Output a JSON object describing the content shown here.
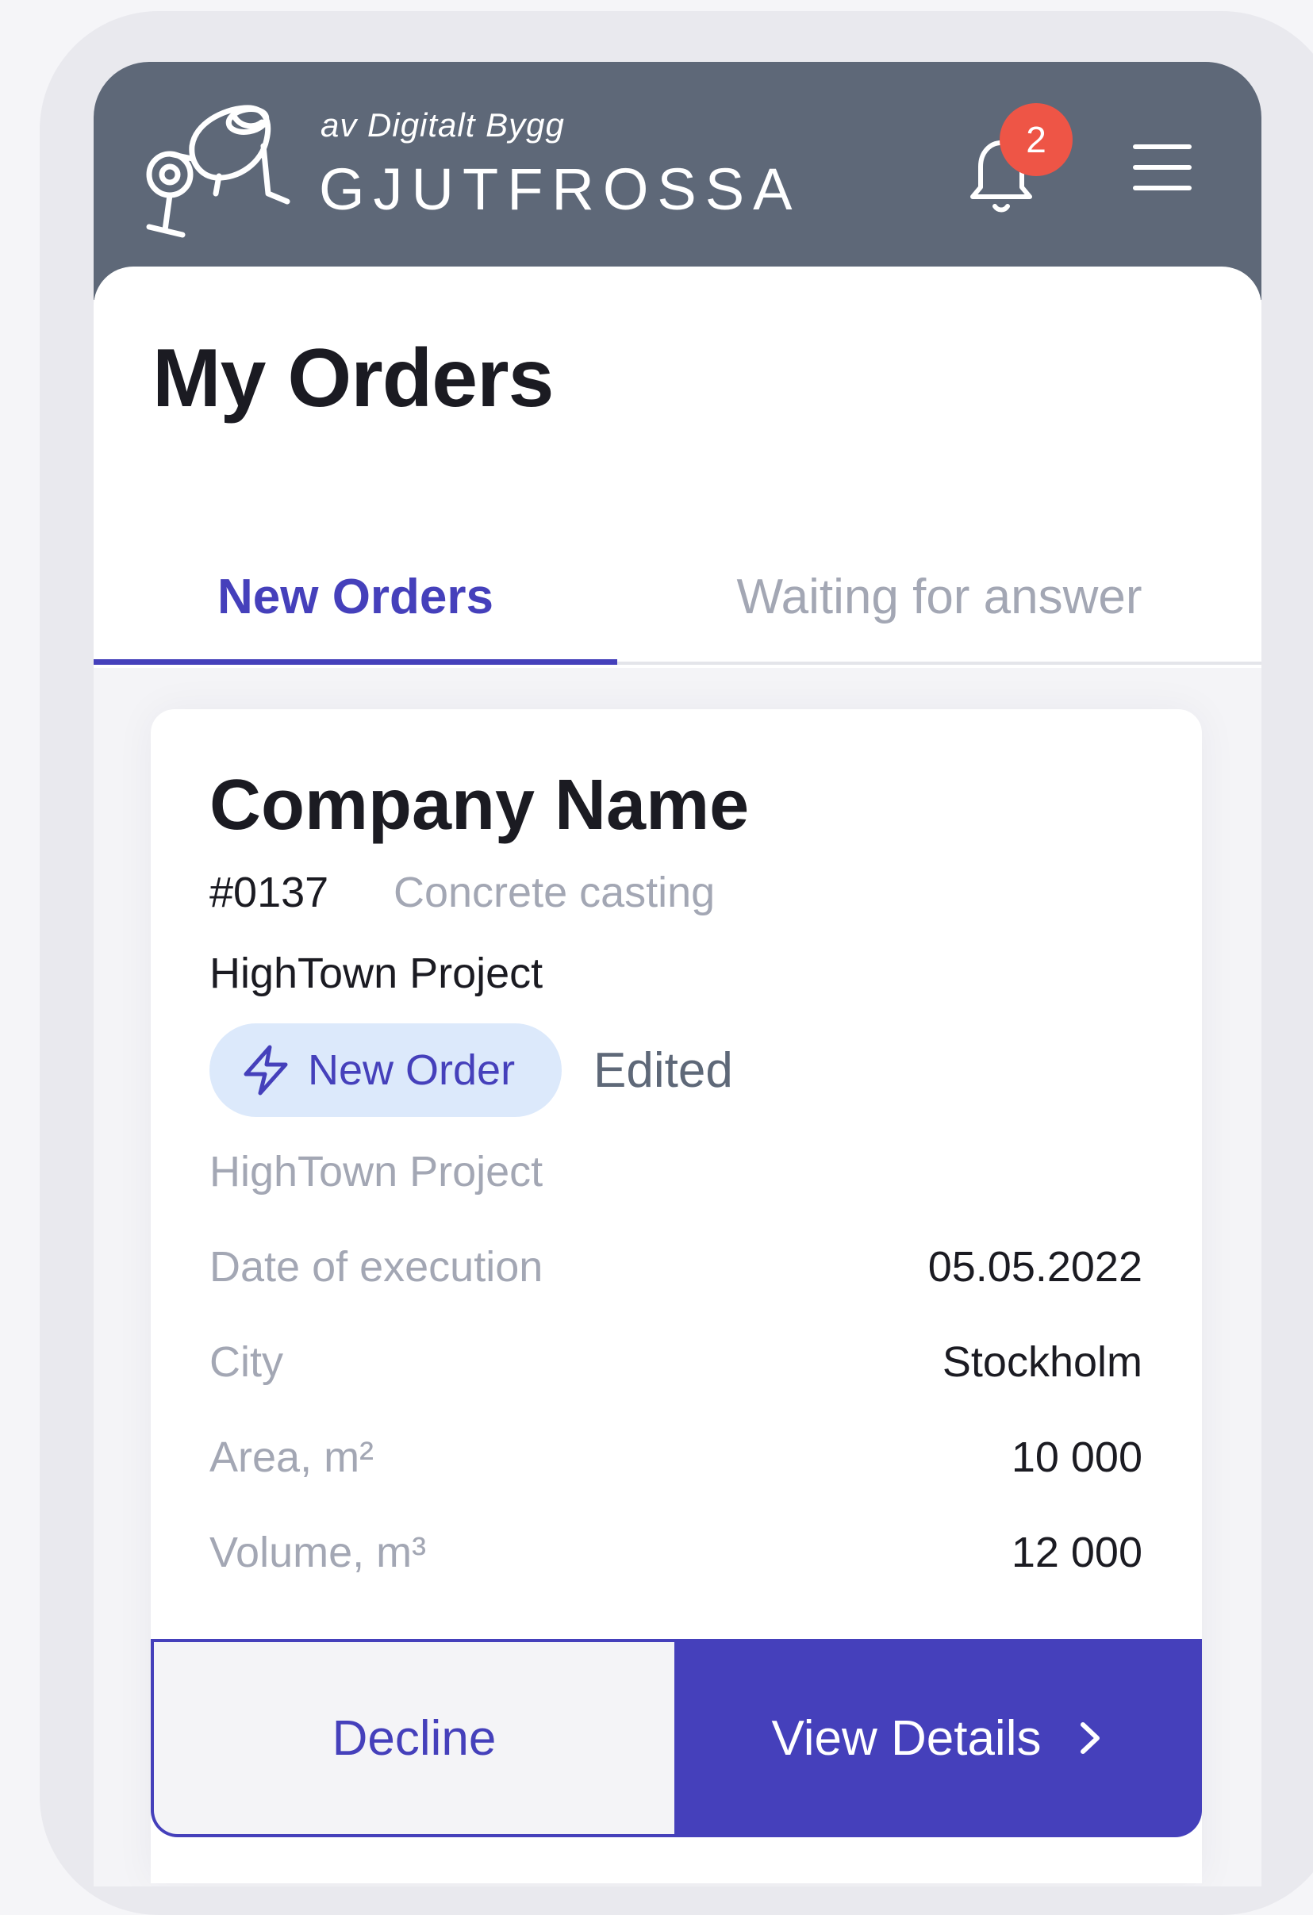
{
  "header": {
    "tagline": "av Digitalt Bygg",
    "brand": "GJUTFROSSA",
    "notification_count": "2",
    "logo_icon": "concrete-mixer-icon",
    "bell_icon": "bell-icon",
    "menu_icon": "hamburger-menu-icon"
  },
  "page": {
    "title": "My Orders"
  },
  "tabs": [
    {
      "label": "New Orders",
      "active": true
    },
    {
      "label": "Waiting for answer",
      "active": false
    }
  ],
  "order": {
    "company": "Company Name",
    "number": "#0137",
    "type": "Concrete casting",
    "project": "HighTown Project",
    "status_icon": "lightning-icon",
    "status": "New Order",
    "edited": "Edited",
    "project_sub": "HighTown Project",
    "details": [
      {
        "label": "Date of execution",
        "value": "05.05.2022"
      },
      {
        "label": "City",
        "value": "Stockholm"
      },
      {
        "label": "Area, m²",
        "value": "10 000"
      },
      {
        "label": "Volume, m³",
        "value": "12 000"
      }
    ],
    "decline_label": "Decline",
    "view_details_label": "View Details",
    "chevron_icon": "chevron-right-icon"
  },
  "colors": {
    "header_bg": "#5e6878",
    "accent": "#4540bb",
    "badge_red": "#ee5546",
    "status_bg": "#dce9fb",
    "muted_text": "#a3a7b4"
  }
}
